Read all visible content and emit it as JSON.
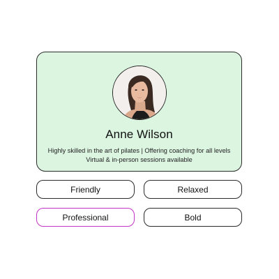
{
  "profile": {
    "name": "Anne Wilson",
    "bio_line_1": "Highly skilled in the art of pilates | Offering coaching for all levels",
    "bio_line_2": "Virtual & in-person sessions available",
    "avatar_icon": "profile-photo"
  },
  "tone_options": [
    {
      "label": "Friendly",
      "selected": false
    },
    {
      "label": "Relaxed",
      "selected": false
    },
    {
      "label": "Professional",
      "selected": true
    },
    {
      "label": "Bold",
      "selected": false
    }
  ],
  "colors": {
    "card_background": "#dcf5e1",
    "selected_border": "#c433c8",
    "border": "#2a2a2a"
  }
}
